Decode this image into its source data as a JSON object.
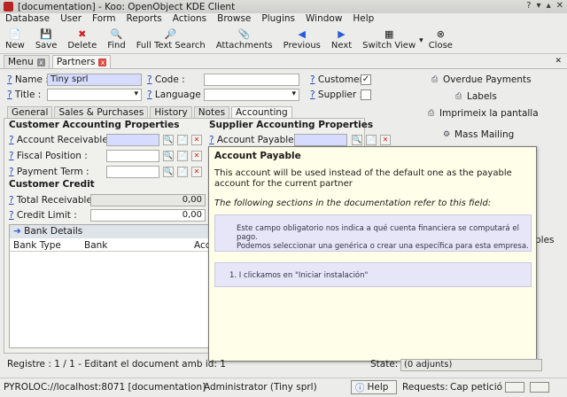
{
  "window": {
    "title": "[documentation] - Koo: OpenObject KDE Client"
  },
  "menubar": [
    "Database",
    "User",
    "Form",
    "Reports",
    "Actions",
    "Browse",
    "Plugins",
    "Window",
    "Help"
  ],
  "toolbar": [
    "New",
    "Save",
    "Delete",
    "Find",
    "Full Text Search",
    "Attachments",
    "Previous",
    "Next",
    "Switch View",
    "Close"
  ],
  "top_tabs": [
    "Menu",
    "Partners"
  ],
  "fields": {
    "name_label": "Name :",
    "name_value": "Tiny sprl",
    "code_label": "Code :",
    "customer_label": "Customer :",
    "title_label": "Title :",
    "language_label": "Language :",
    "supplier_label": "Supplier :"
  },
  "subtabs": [
    "General",
    "Sales & Purchases",
    "History",
    "Notes",
    "Accounting"
  ],
  "accounting": {
    "customer_section": "Customer Accounting Properties",
    "account_receivable": "Account Receivable :",
    "fiscal_position": "Fiscal Position :",
    "payment_term": "Payment Term :",
    "supplier_section": "Supplier Accounting Properties",
    "account_payable": "Account Payable :",
    "credit_section": "Customer Credit",
    "total_receivable": "Total Receivable :",
    "total_receivable_value": "0,00",
    "credit_limit": "Credit Limit :",
    "credit_limit_value": "0,00"
  },
  "bank": {
    "header": "Bank Details",
    "cols": [
      "Bank Type",
      "Bank",
      "Acc"
    ]
  },
  "right_actions": [
    "Overdue Payments",
    "Labels",
    "Imprimeix la pantalla",
    "Mass Mailing"
  ],
  "right_partial": "bles",
  "popup": {
    "title": "Account Payable",
    "text": "This account will be used instead of the default one as the payable account for the current partner",
    "ref": "The following sections in the documentation refer to this field:",
    "doc1_line1": "Este campo obligatorio nos indica a qué cuenta financiera se computará el pago.",
    "doc1_line2": "Podemos seleccionar una genérica o crear una específica para esta empresa.",
    "doc2": "1.   I clickamos en \"Iniciar instalación\""
  },
  "status": {
    "record": "Registre : 1 / 1 - Editant el document amb id: 1",
    "state_label": "State:",
    "state_value": "(0 adjunts)"
  },
  "statusbar": {
    "server": "PYROLOC://localhost:8071 [documentation]",
    "user": "Administrator (Tiny sprl)",
    "help": "Help",
    "requests": "Requests:",
    "cap": "Cap petició"
  },
  "colors": {
    "required": "#d6dcff",
    "tooltip": "#fffee8",
    "doc_box": "#e6e6f8"
  }
}
